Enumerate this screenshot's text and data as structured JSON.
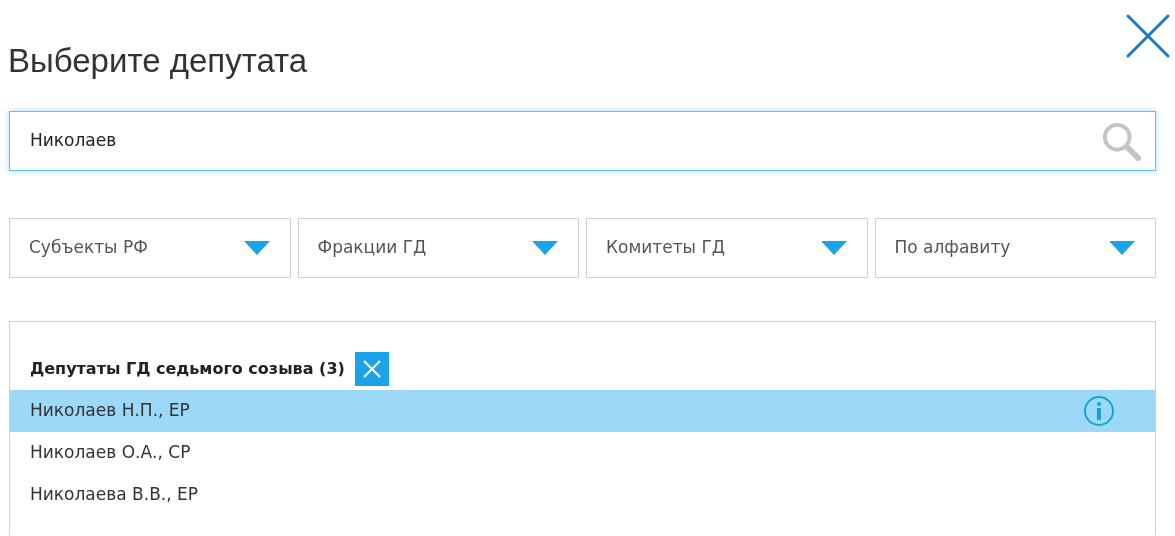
{
  "title": "Выберите депутата",
  "search": {
    "value": "Николаев"
  },
  "filters": [
    {
      "label": "Субъекты РФ"
    },
    {
      "label": "Фракции ГД"
    },
    {
      "label": "Комитеты ГД"
    },
    {
      "label": "По алфавиту"
    }
  ],
  "results": {
    "heading": "Депутаты ГД седьмого созыва (3)",
    "items": [
      {
        "label": "Николаев Н.П., ЕР",
        "selected": true
      },
      {
        "label": "Николаев О.А., СР",
        "selected": false
      },
      {
        "label": "Николаева В.В., ЕР",
        "selected": false
      }
    ]
  }
}
